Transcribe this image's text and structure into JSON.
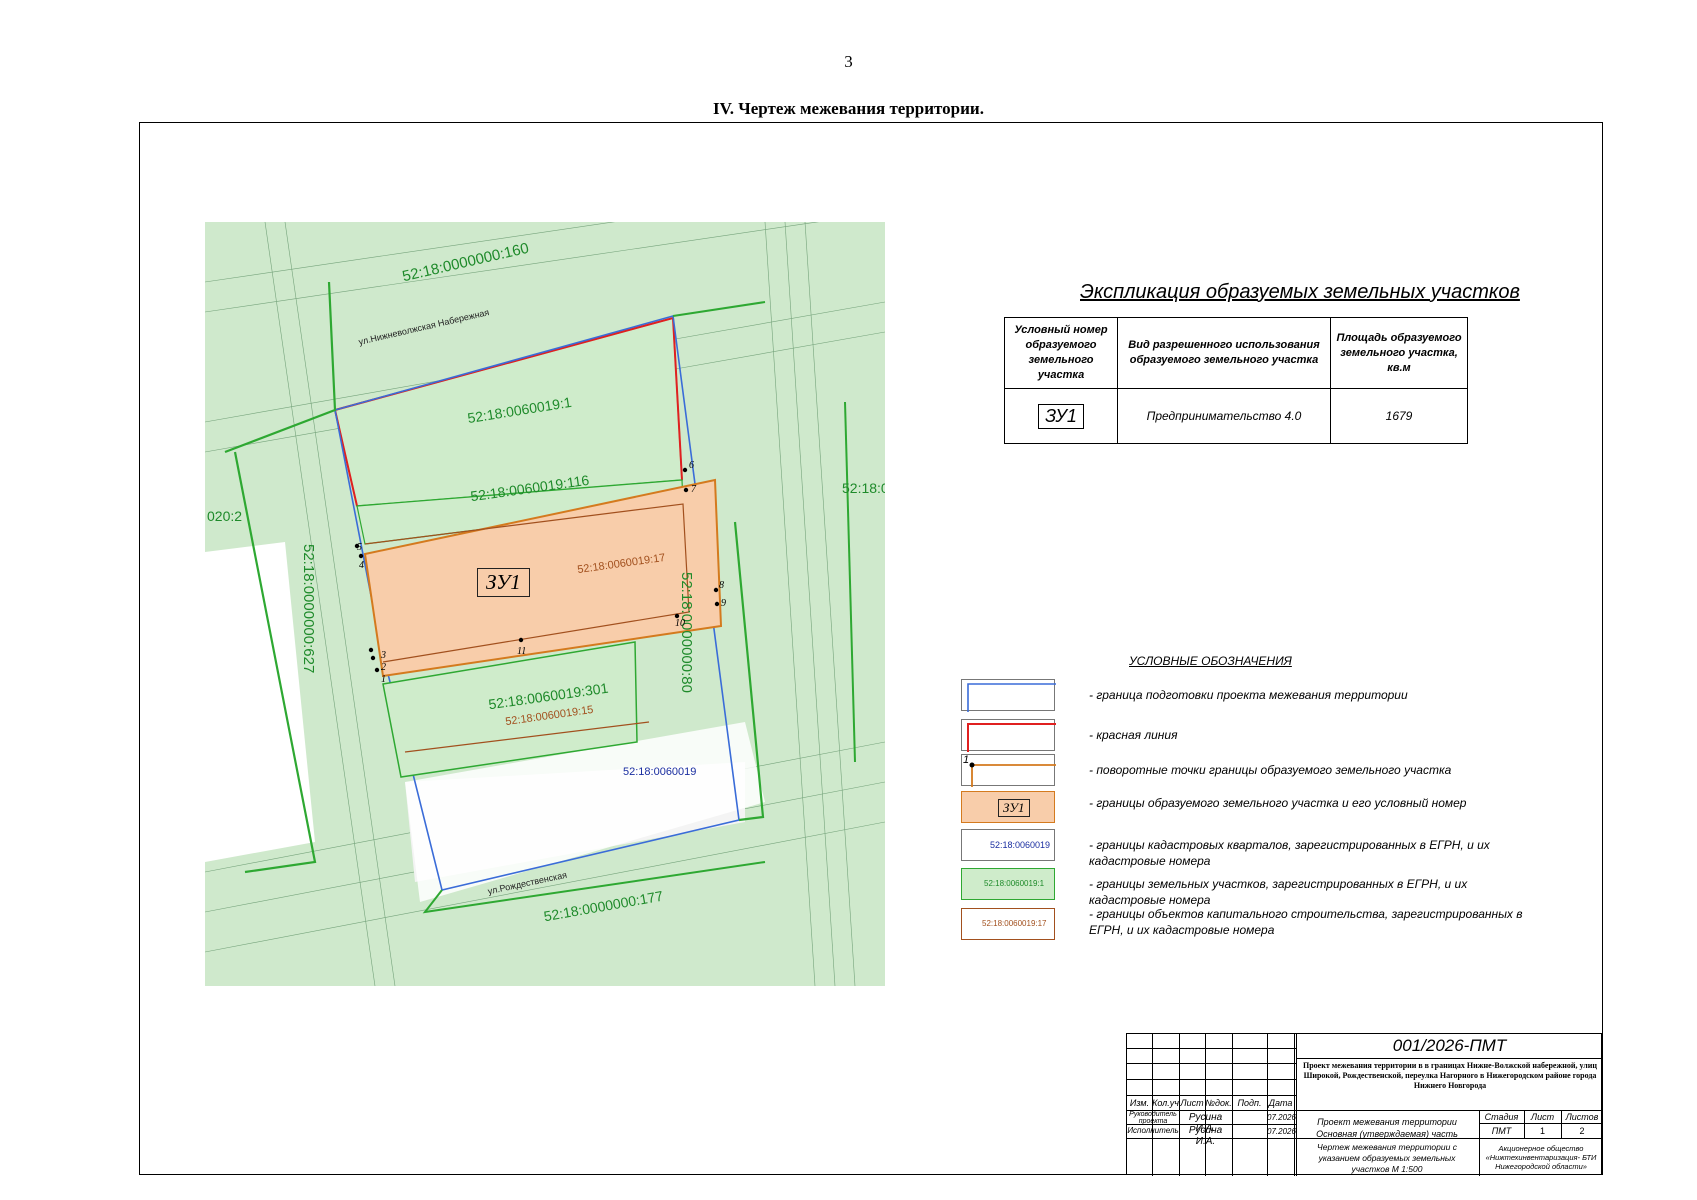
{
  "page": {
    "number": "3",
    "section_title": "IV.    Чертеж межевания территории."
  },
  "map": {
    "parcels": {
      "big_top": "52:18:0000000:160",
      "p1": "52:18:0060019:1",
      "p116": "52:18:0060019:116",
      "p17": "52:18:0060019:17",
      "p301": "52:18:0060019:301",
      "p15": "52:18:0060019:15",
      "quarter": "52:18:0060019",
      "right_vertical": "52:18:0000000:80",
      "left_vertical": "52:18:0000000:627",
      "bottom": "52:18:0000000:177",
      "left_partial": "020:2",
      "right_partial": "52:18:0"
    },
    "zu_label": "ЗУ1",
    "street_top": "ул.Нижневолжская Набережная",
    "street_bottom": "ул.Рождественская",
    "points": [
      "1",
      "2",
      "3",
      "4",
      "5",
      "6",
      "7",
      "8",
      "9",
      "10",
      "11"
    ]
  },
  "explication": {
    "title": "Экспликация образуемых земельных участков",
    "headers": [
      "Условный номер образуемого земельного участка",
      "Вид разрешенного использования образуемого земельного участка",
      "Площадь образуемого земельного участка, кв.м"
    ],
    "rows": [
      {
        "num": "ЗУ1",
        "use": "Предпринимательство 4.0",
        "area": "1679"
      }
    ]
  },
  "legend": {
    "title": "УСЛОВНЫЕ ОБОЗНАЧЕНИЯ",
    "items": [
      "- граница подготовки проекта межевания территории",
      "- красная линия",
      "- поворотные точки границы образуемого земельного участка",
      "- границы образуемого земельного участка и его условный номер",
      "- границы кадастровых кварталов, зарегистрированных в ЕГРН, и их кадастровые номера",
      "- границы земельных участков, зарегистрированных в ЕГРН, и их кадастровые номера",
      "- границы объектов капитального строительства, зарегистрированных в ЕГРН, и их кадастровые номера"
    ],
    "sample_point": "1",
    "sample_zu": "ЗУ1",
    "sample_quarter": "52:18:0060019",
    "sample_parcel": "52:18:0060019:1",
    "sample_oks": "52:18:0060019:17"
  },
  "stamp": {
    "code": "001/2026-ПМТ",
    "project_title": "Проект межевания территории в в границах Нижне-Волжской набережной, улиц Широкой, Рождественской, переулка Нагорного в Нижегородском районе города Нижнего Новгорода",
    "col_headers": [
      "Изм.",
      "Кол.уч",
      "Лист",
      "№док.",
      "Подп.",
      "Дата"
    ],
    "roles": [
      {
        "role": "Руководитель проекта",
        "name": "Русина И.А.",
        "date": "07.2026"
      },
      {
        "role": "Исполнитель",
        "name": "Русина И.А.",
        "date": "07.2026"
      }
    ],
    "section": "Проект межевания территории Основная (утверждаемая) часть",
    "stage_headers": [
      "Стадия",
      "Лист",
      "Листов"
    ],
    "stage_values": [
      "ПМТ",
      "1",
      "2"
    ],
    "sheet_title": "Чертеж межевания территории с указанием образуемых земельных участков М 1:500",
    "org": "Акционерное общество «Нижтехинвентаризация- БТИ Нижегородской области»"
  }
}
